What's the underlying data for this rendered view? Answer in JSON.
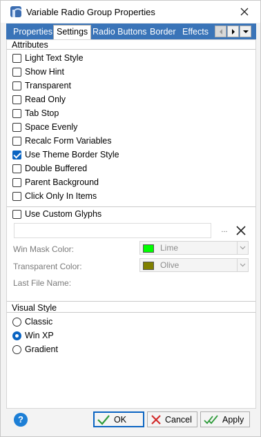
{
  "window": {
    "title": "Variable Radio Group Properties",
    "app_icon": "radio-group-icon",
    "close_icon": "close-icon"
  },
  "tabs": [
    {
      "label": "Properties",
      "active": false
    },
    {
      "label": "Settings",
      "active": true
    },
    {
      "label": "Radio Buttons",
      "active": false
    },
    {
      "label": "Border",
      "active": false
    },
    {
      "label": "Effects",
      "active": false
    }
  ],
  "tab_scroll": {
    "left_icon": "chevron-left-icon",
    "right_icon": "chevron-right-icon",
    "menu_icon": "chevron-down-icon"
  },
  "attributes": {
    "title": "Attributes",
    "items": [
      {
        "label": "Light Text Style",
        "checked": false
      },
      {
        "label": "Show Hint",
        "checked": false
      },
      {
        "label": "Transparent",
        "checked": false
      },
      {
        "label": "Read Only",
        "checked": false
      },
      {
        "label": "Tab Stop",
        "checked": false
      },
      {
        "label": "Space Evenly",
        "checked": false
      },
      {
        "label": "Recalc Form Variables",
        "checked": false
      },
      {
        "label": "Use Theme Border Style",
        "checked": true
      },
      {
        "label": "Double Buffered",
        "checked": false
      },
      {
        "label": "Parent Background",
        "checked": false
      },
      {
        "label": "Click Only In Items",
        "checked": false
      }
    ]
  },
  "glyphs": {
    "use_custom_label": "Use Custom Glyphs",
    "use_custom_checked": false,
    "file_value": "",
    "browse_label": "...",
    "clear_icon": "close-icon",
    "win_mask_label": "Win Mask Color:",
    "win_mask_value": "Lime",
    "win_mask_color": "#00ff00",
    "transparent_label": "Transparent Color:",
    "transparent_value": "Olive",
    "transparent_color": "#808000",
    "last_file_label": "Last File Name:"
  },
  "visual_style": {
    "title": "Visual Style",
    "options": [
      {
        "label": "Classic",
        "selected": false
      },
      {
        "label": "Win XP",
        "selected": true
      },
      {
        "label": "Gradient",
        "selected": false
      }
    ]
  },
  "footer": {
    "help_label": "?",
    "ok_label": "OK",
    "cancel_label": "Cancel",
    "apply_label": "Apply"
  },
  "colors": {
    "tab_bar": "#3a74b8",
    "accent": "#0a64c2",
    "ok_check": "#2e9b3a",
    "cancel_x": "#d12a2a"
  }
}
